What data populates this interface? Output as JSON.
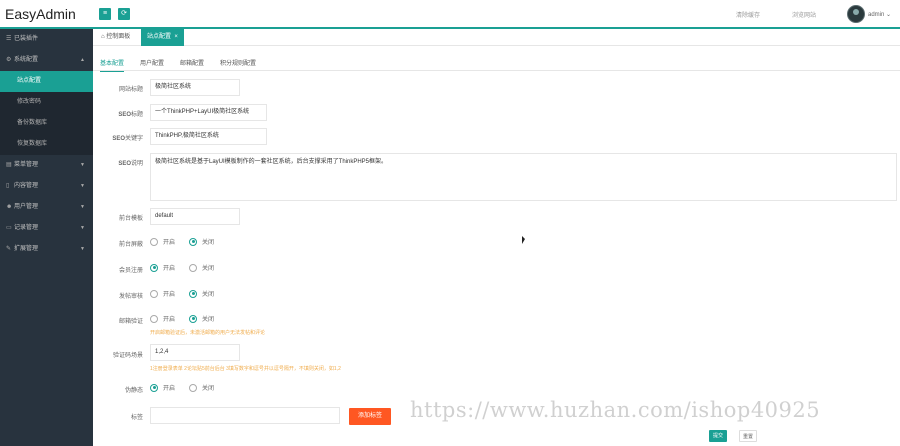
{
  "app": {
    "logo": "EasyAdmin"
  },
  "header": {
    "menu_icon": "menu-icon",
    "refresh_icon": "refresh-icon",
    "link1": "清除缓存",
    "link2": "浏览网站",
    "user": "admin"
  },
  "sidebar": {
    "items": [
      {
        "label": "已装插件",
        "icon": "grid-icon"
      },
      {
        "label": "系统配置",
        "icon": "gear-icon",
        "expanded": true
      },
      {
        "label": "菜单管理",
        "icon": "list-icon"
      },
      {
        "label": "内容管理",
        "icon": "doc-icon"
      },
      {
        "label": "用户管理",
        "icon": "users-icon"
      },
      {
        "label": "记录管理",
        "icon": "record-icon"
      },
      {
        "label": "扩展管理",
        "icon": "wrench-icon"
      }
    ],
    "subitems": [
      {
        "label": "站点配置",
        "active": true
      },
      {
        "label": "修改密码"
      },
      {
        "label": "备份数据库"
      },
      {
        "label": "恢复数据库"
      }
    ]
  },
  "tabs": [
    {
      "label": "控制面板",
      "icon": "home-icon"
    },
    {
      "label": "站点配置",
      "active": true,
      "close": "×"
    }
  ],
  "subtabs": [
    "基本配置",
    "用户配置",
    "邮箱配置",
    "积分规则配置"
  ],
  "form": {
    "site_title": {
      "label": "网站标题",
      "value": "极简社区系统"
    },
    "seo_title": {
      "label_a": "SEO",
      "label_b": "标题",
      "value": "一个ThinkPHP+LayUI极简社区系统"
    },
    "seo_keywords": {
      "label_a": "SEO",
      "label_b": "关键字",
      "value": "ThinkPHP,极简社区系统"
    },
    "seo_desc": {
      "label_a": "SEO",
      "label_b": "说明",
      "value": "极简社区系统是基于LayUI模板制作的一套社区系统，后台支撑采用了ThinkPHP5框架。"
    },
    "front_template": {
      "label": "前台模板",
      "value": "default"
    },
    "front_shield": {
      "label": "前台屏蔽",
      "on": "开启",
      "off": "关闭",
      "selected": "off"
    },
    "member_register": {
      "label": "会员注册",
      "on": "开启",
      "off": "关闭",
      "selected": "on"
    },
    "post_review": {
      "label": "发帖审核",
      "on": "开启",
      "off": "关闭",
      "selected": "off"
    },
    "email_verify": {
      "label": "邮箱验证",
      "on": "开启",
      "off": "关闭",
      "selected": "off",
      "hint": "开启邮箱验证后，未激活邮箱的用户无法发帖和评论"
    },
    "captcha": {
      "label": "验证码场景",
      "value": "1,2,4",
      "hint": "1注册登录表单 2论坛贴5前台后台 3填写数字和逗号并以逗号隔开，不填则关闭，如1,2"
    },
    "pseudo_static": {
      "label": "伪静态",
      "on": "开启",
      "off": "关闭",
      "selected": "on"
    },
    "tags": {
      "label": "标签",
      "value": "",
      "add_button": "添加标签"
    }
  },
  "actions": {
    "submit": "提交",
    "reset": "重置"
  },
  "watermark": "https://www.huzhan.com/ishop40925",
  "colors": {
    "accent": "#1aa094",
    "sidebar": "#28333e",
    "orange": "#ff5722",
    "hint": "#f0ad4e"
  }
}
